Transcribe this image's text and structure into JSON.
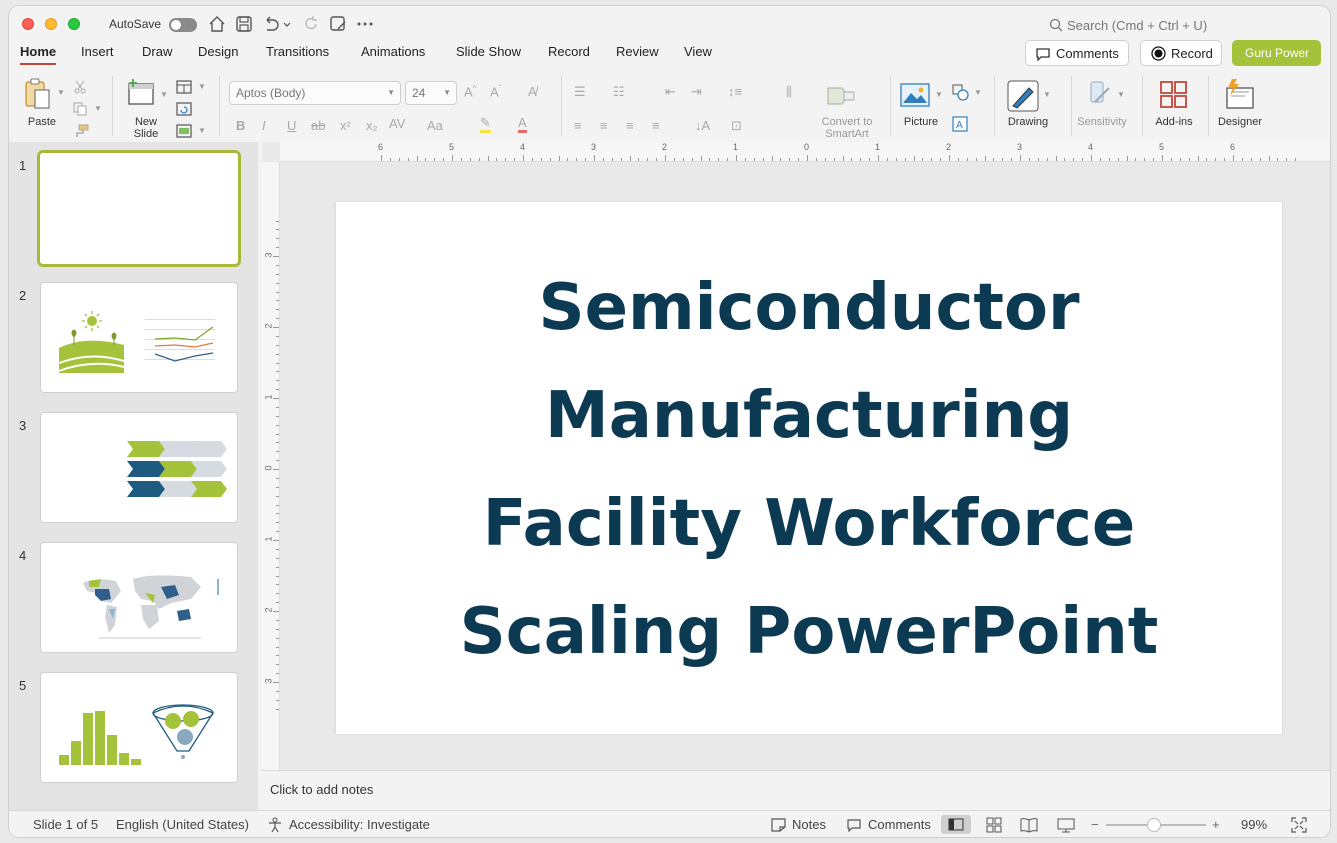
{
  "titlebar": {
    "autosave_label": "AutoSave",
    "search_placeholder": "Search (Cmd + Ctrl + U)"
  },
  "tabs": [
    {
      "label": "Home",
      "active": true
    },
    {
      "label": "Insert"
    },
    {
      "label": "Draw"
    },
    {
      "label": "Design"
    },
    {
      "label": "Transitions"
    },
    {
      "label": "Animations"
    },
    {
      "label": "Slide Show"
    },
    {
      "label": "Record"
    },
    {
      "label": "Review"
    },
    {
      "label": "View"
    }
  ],
  "actions": {
    "comments": "Comments",
    "record": "Record",
    "guru": "Guru Power"
  },
  "ribbon": {
    "paste": "Paste",
    "new_slide": "New\nSlide",
    "font_name": "Aptos (Body)",
    "font_size": "24",
    "convert_smartart": "Convert to\nSmartArt",
    "picture": "Picture",
    "drawing": "Drawing",
    "sensitivity": "Sensitivity",
    "addins": "Add-ins",
    "designer": "Designer"
  },
  "thumbnails": [
    {
      "num": "1"
    },
    {
      "num": "2"
    },
    {
      "num": "3"
    },
    {
      "num": "4"
    },
    {
      "num": "5"
    }
  ],
  "slide": {
    "title_lines": [
      "Semiconductor",
      "Manufacturing",
      "Facility Workforce",
      "Scaling PowerPoint"
    ]
  },
  "notes_placeholder": "Click to add notes",
  "status": {
    "slide_of": "Slide 1 of 5",
    "language": "English (United States)",
    "accessibility": "Accessibility: Investigate",
    "notes": "Notes",
    "comments": "Comments",
    "zoom": "99%"
  },
  "ruler": {
    "h_ticks": [
      "6",
      "5",
      "4",
      "3",
      "2",
      "1",
      "0",
      "1",
      "2",
      "3",
      "4",
      "5",
      "6"
    ],
    "v_ticks": [
      "3",
      "2",
      "1",
      "0",
      "1",
      "2",
      "3"
    ]
  },
  "colors": {
    "accent_green": "#a5c23b",
    "title_navy": "#0c3a52",
    "tab_underline": "#c1463a"
  }
}
